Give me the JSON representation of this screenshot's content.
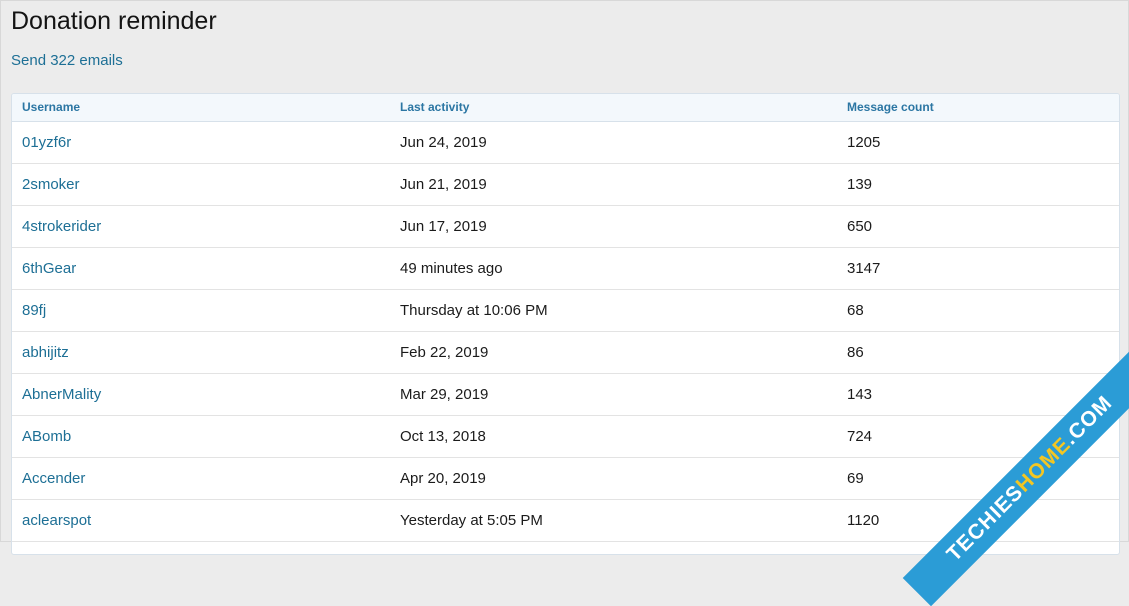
{
  "page": {
    "title": "Donation reminder",
    "send_link": "Send 322 emails"
  },
  "table": {
    "headers": [
      "Username",
      "Last activity",
      "Message count"
    ],
    "rows": [
      {
        "username": "01yzf6r",
        "last_activity": "Jun 24, 2019",
        "message_count": "1205"
      },
      {
        "username": "2smoker",
        "last_activity": "Jun 21, 2019",
        "message_count": "139"
      },
      {
        "username": "4strokerider",
        "last_activity": "Jun 17, 2019",
        "message_count": "650"
      },
      {
        "username": "6thGear",
        "last_activity": "49 minutes ago",
        "message_count": "3147"
      },
      {
        "username": "89fj",
        "last_activity": "Thursday at 10:06 PM",
        "message_count": "68"
      },
      {
        "username": "abhijitz",
        "last_activity": "Feb 22, 2019",
        "message_count": "86"
      },
      {
        "username": "AbnerMality",
        "last_activity": "Mar 29, 2019",
        "message_count": "143"
      },
      {
        "username": "ABomb",
        "last_activity": "Oct 13, 2018",
        "message_count": "724"
      },
      {
        "username": "Accender",
        "last_activity": "Apr 20, 2019",
        "message_count": "69"
      },
      {
        "username": "aclearspot",
        "last_activity": "Yesterday at 5:05 PM",
        "message_count": "1120"
      }
    ]
  },
  "watermark": {
    "prefix": "TECHIES",
    "accent": "HOME",
    "suffix": ".COM"
  },
  "colors": {
    "link": "#1d6f95",
    "header_text": "#2b76a3",
    "header_bg": "#f3f8fc",
    "page_bg": "#ececec"
  }
}
